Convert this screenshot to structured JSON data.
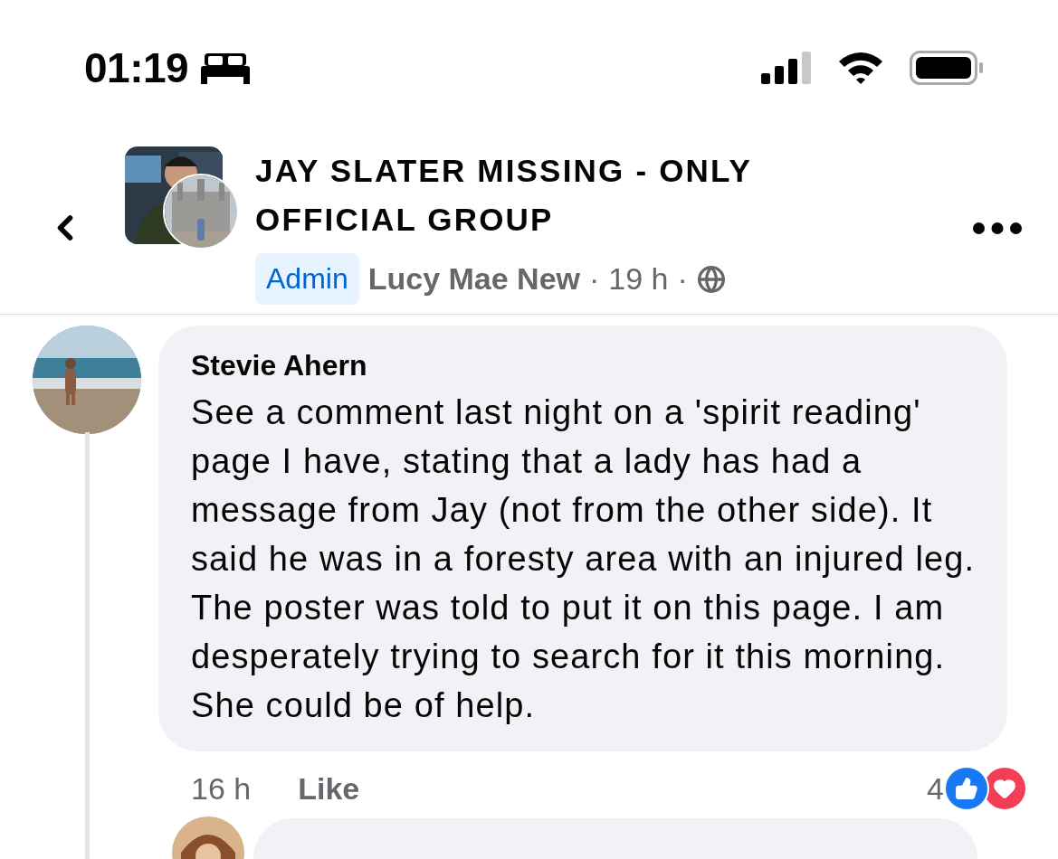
{
  "status_bar": {
    "time": "01:19"
  },
  "header": {
    "group_name": "JAY SLATER MISSING - ONLY OFFICIAL GROUP",
    "badge": "Admin",
    "author": "Lucy Mae New",
    "separator_1": "·",
    "time": "19 h",
    "separator_2": "·"
  },
  "comments": [
    {
      "author": "Stevie Ahern",
      "text": "See a comment last night on a 'spirit reading' page I have, stating that a lady has had a message from Jay (not from the other side). It said he was in a foresty area with an injured leg. The poster was told to put it on this page. I am desperately trying to search for it this morning. She could be of help.",
      "time": "16 h",
      "like": "Like",
      "reaction_count": "4"
    }
  ]
}
